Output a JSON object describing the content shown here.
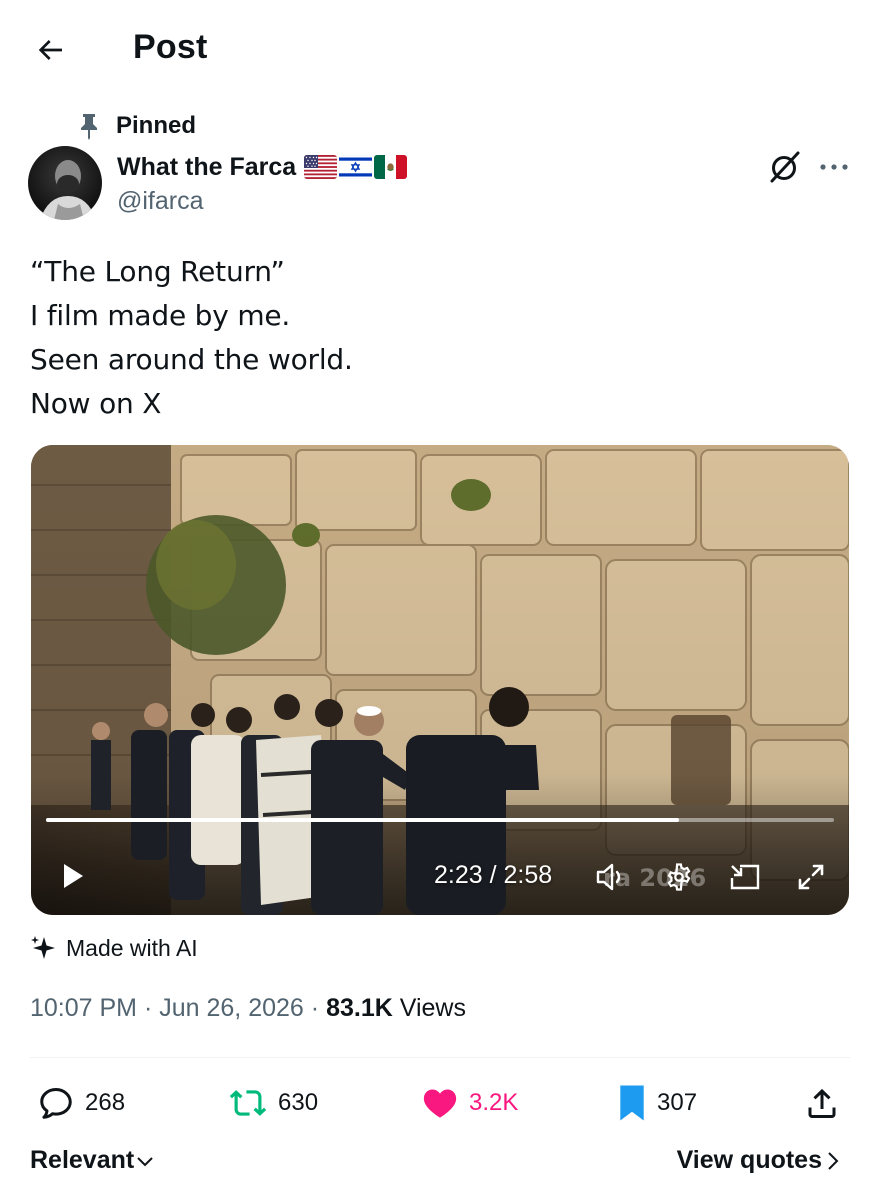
{
  "header": {
    "title": "Post",
    "back_icon": "arrow-left-icon"
  },
  "post": {
    "pinned_label": "Pinned",
    "author": {
      "name": "What the Farca",
      "handle": "@ifarca",
      "flags": [
        "us-flag",
        "israel-flag",
        "mexico-flag"
      ]
    },
    "text_lines": [
      "“The Long Return”",
      "I film made by me.",
      "Seen around the world.",
      "Now on X"
    ],
    "video": {
      "time": "2:23 / 2:58",
      "progress": 0.803,
      "watermark": "ra   2026"
    },
    "ai_label": "Made with AI",
    "meta": {
      "time": "10:07 PM",
      "separator": "·",
      "date": "Jun 26, 2026",
      "views_count": "83.1K",
      "views_label": "Views"
    },
    "stats": {
      "replies": "268",
      "reposts": "630",
      "likes": "3.2K",
      "bookmarks": "307"
    }
  },
  "footer": {
    "sort_label": "Relevant",
    "view_quotes_label": "View quotes"
  },
  "colors": {
    "text_primary": "#0f1419",
    "text_secondary": "#536471",
    "like_pink": "#f91880",
    "repost_green": "#00ba7c",
    "bookmark_blue": "#1d9bf0"
  }
}
